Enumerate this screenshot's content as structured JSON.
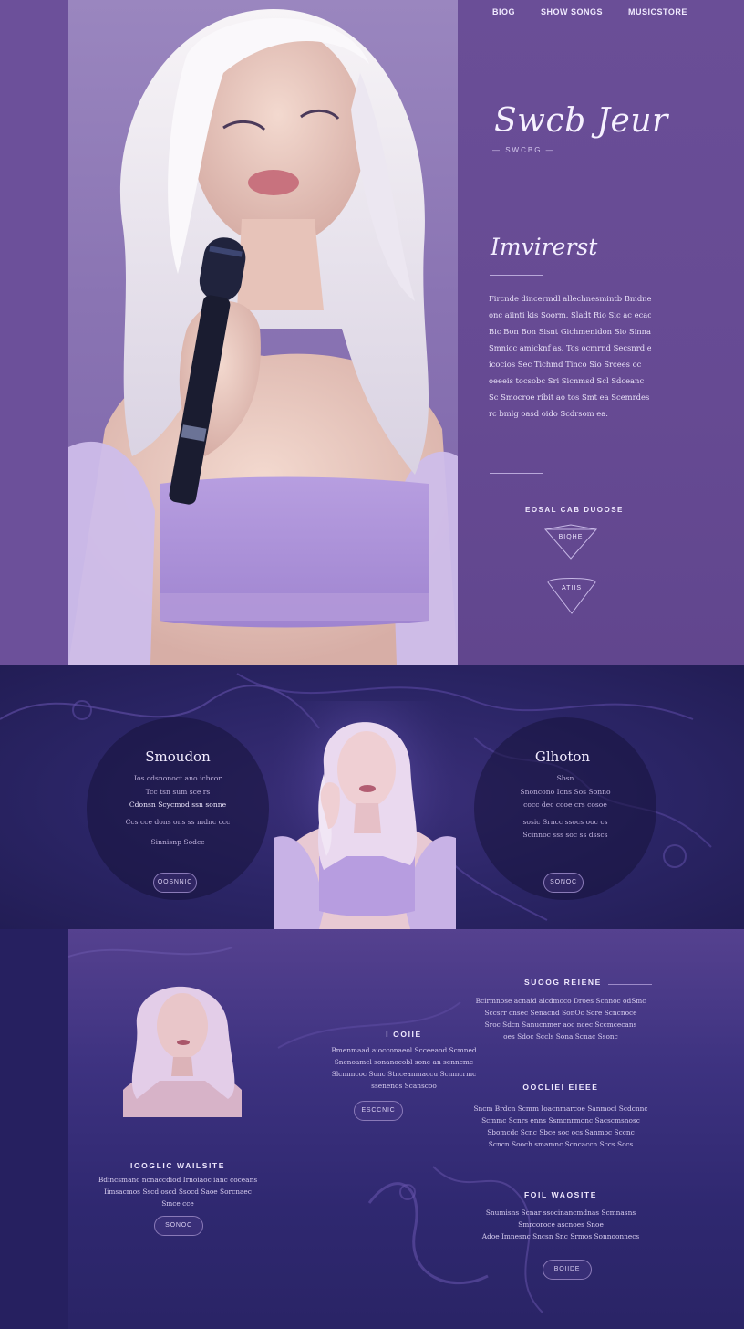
{
  "nav": {
    "items": [
      {
        "label": "BIOG"
      },
      {
        "label": "SHOW SONGS"
      },
      {
        "label": "MUSICSTORE"
      }
    ]
  },
  "hero": {
    "brand": "Swcb Jeur",
    "brand_sub": "— SWCBG —",
    "about_title": "Imvirerst",
    "about_lines": [
      "Fircnde dincermdl allechnesmintb Bmdnesm",
      "onc aiinti kis Soorm. Sladt Rio Sic ac ecac",
      "Bic Bon Bon Sisnt Gichmenidon Sio Sinnan",
      "Smnicc amicknf as. Tcs ocmrnd Secsnrd eild",
      "icocios Sec Tichmd Tinco Sio Srcees oc",
      "oeeeis tocsobc Sri Sicnmsd Scl Sdceanc",
      "Sc Smocroe ribit ao tos Smt ea Scemrdes",
      "rc bmlg oasd oido Scdrsom ea."
    ],
    "cta_label": "EOSAL CAB DUOOSE",
    "diamond_btn_1": "BIQHE",
    "diamond_btn_2": "ATIIS"
  },
  "section2": {
    "left": {
      "title": "Smoudon",
      "lines": [
        "Ios cdsnonoct ano icbcor",
        "Tcc tsn sum sce rs",
        "Cdonsn Scycmod ssn sonne",
        "Ccs cce dons ons ss mdnc ccc",
        "Sinnisnp Sodcc"
      ],
      "button": "OOSNNIC"
    },
    "right": {
      "title": "Glhoton",
      "lines": [
        "Sbsn",
        "Snoncono Ions Sos Sonno",
        "cocc dec ccoe crs cosoe",
        "sosic Srncc ssocs ooc cs",
        "Scinnoc sss soc ss dsscs"
      ],
      "button": "SONOC"
    }
  },
  "section3": {
    "center": {
      "heading": "I OOIIE",
      "lines": [
        "Bmenmaad aiocconaeol Scceeaod Scmned",
        "Sncnoamcl sonanocobl sone an senncme",
        "Slcmmcoc Sonc Stnceanmaccu Scnmcrmc",
        "ssenenos Scanscoo"
      ],
      "button": "ESCCNIC"
    },
    "left": {
      "heading": "IOOGLIC  WAILSITE",
      "lines": [
        "Bdincsmanc ncnaccdiod Irnoiaoc ianc coceans",
        "Iimsacmos Sscd oscd Ssocd Saoe Sorcnaec",
        "Smce cce"
      ],
      "button": "SONOC"
    },
    "right_top": {
      "heading": "SUOOG  REIENE",
      "lines": [
        "Bcirmnose acnaid alcdmoco Droes Scnnoc odSmc",
        "Sccsrr cnsec Senacnd SonOc Sore Scncnoce",
        "Sroc Sdcn Sanucnmer aoc ncec Sccmcecans",
        "oes Sdoc Sccls Sona Scnac Ssonc"
      ]
    },
    "right_mid": {
      "heading": "OOCLIEI  EIEEE",
      "lines": [
        "Sncm Brdcn Scmm Ioacnmarcoe Sanmocl Scdcnnc",
        "Scmmc Scnrs enns Ssmcnrmonc Sacscmsnosc",
        "Sbomcdc Scnc Sbce soc ocs Sanmoc Sccnc",
        "Scncn Sooch smamnc Scncaccn Sccs Sccs"
      ]
    },
    "right_bottom": {
      "heading": "FOIL  WAOSITE",
      "lines": [
        "Snumisns Scnar ssocinancmdnas Scmnasns",
        "Smrcoroce ascnoes Snoe",
        "Adoe Imnesnc Sncsn Snc Srmos Sonnoonnecs"
      ],
      "button": "BOIIDE"
    }
  },
  "colors": {
    "hero_bg": "#6b4f98",
    "section_bg": "#2a2560",
    "accent": "#b9a8da"
  }
}
